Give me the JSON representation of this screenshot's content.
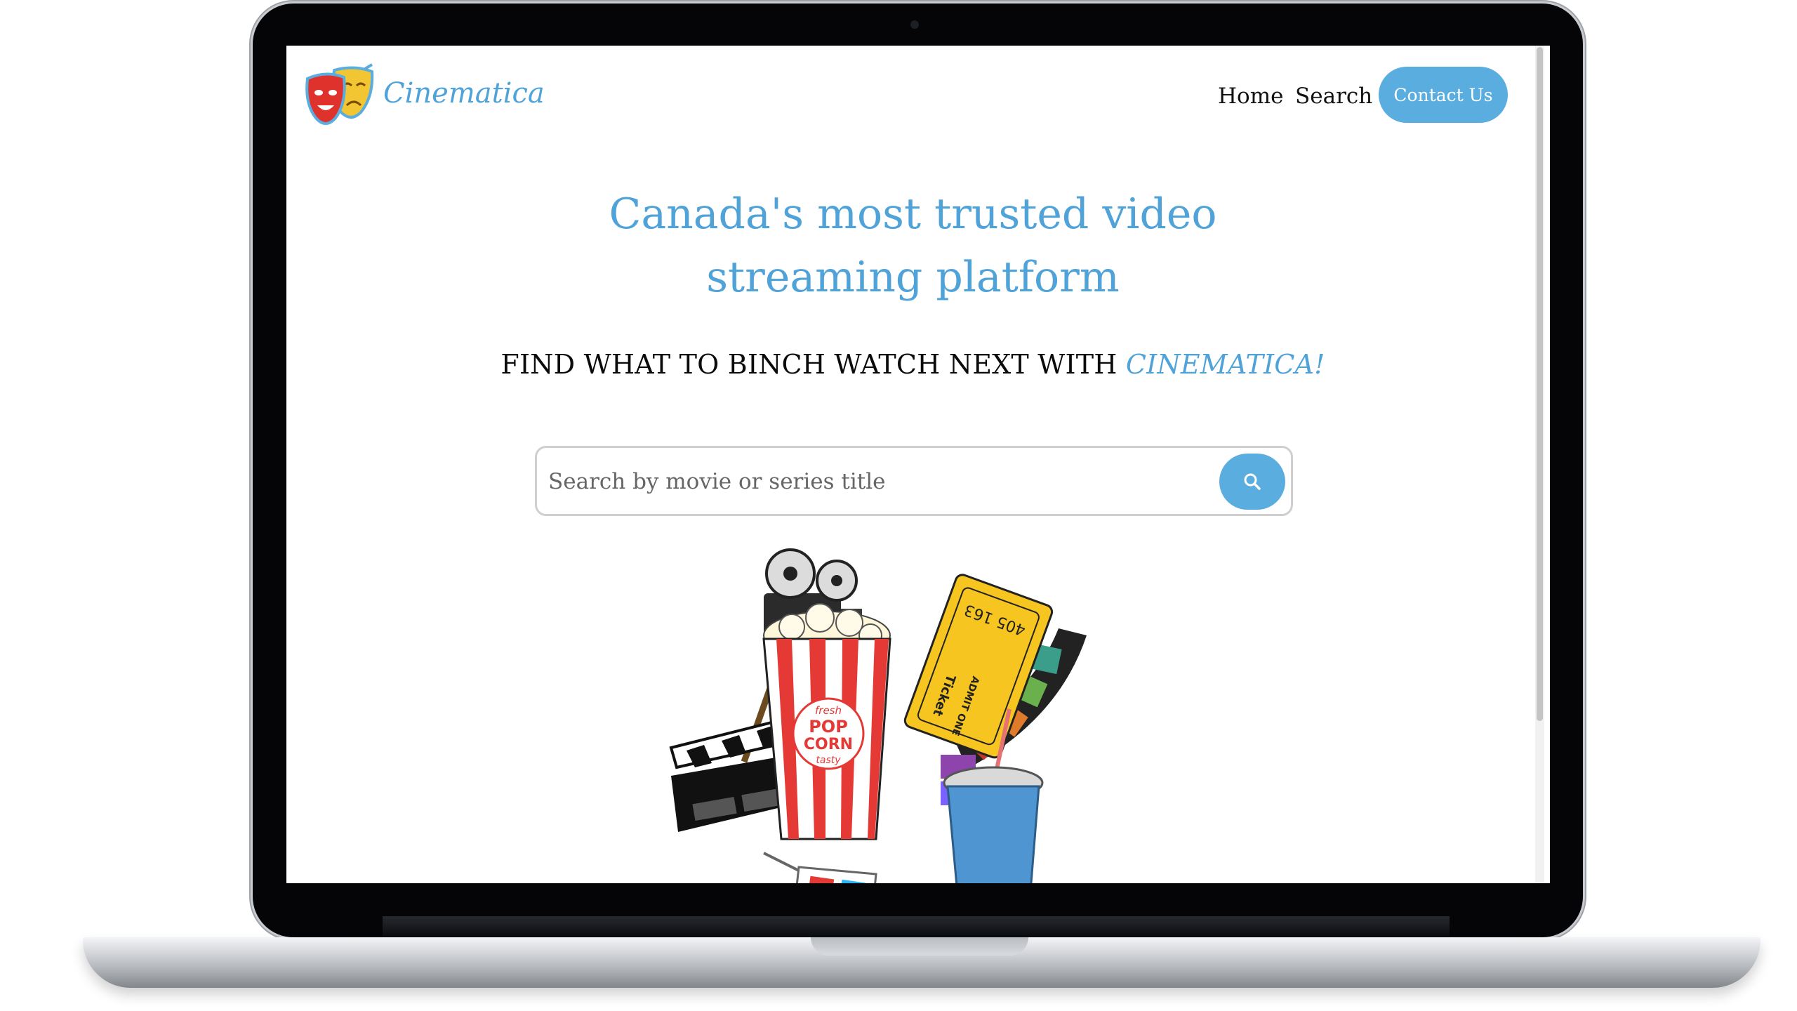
{
  "brand": {
    "name": "Cinematica",
    "logo_icon": "theatre-masks-icon"
  },
  "nav": {
    "items": [
      {
        "label": "Home"
      },
      {
        "label": "Search"
      }
    ],
    "contact_label": "Contact Us"
  },
  "hero": {
    "headline": "Canada's most trusted video streaming platform",
    "tagline_prefix": "FIND WHAT TO BINCH WATCH NEXT WITH ",
    "tagline_accent": "CINEMATICA!"
  },
  "search": {
    "placeholder": "Search by movie or series title",
    "value": "",
    "button_icon": "search-icon"
  },
  "illustration": {
    "ticket_number": "405 163",
    "ticket_word": "Ticket",
    "ticket_admit": "ADMIT ONE",
    "popcorn_top": "fresh",
    "popcorn_line1": "POP",
    "popcorn_line2": "CORN",
    "popcorn_bottom": "tasty"
  },
  "colors": {
    "accent": "#4fa3d8",
    "button": "#5aaddf",
    "text": "#111111",
    "bezel": "#050507"
  }
}
